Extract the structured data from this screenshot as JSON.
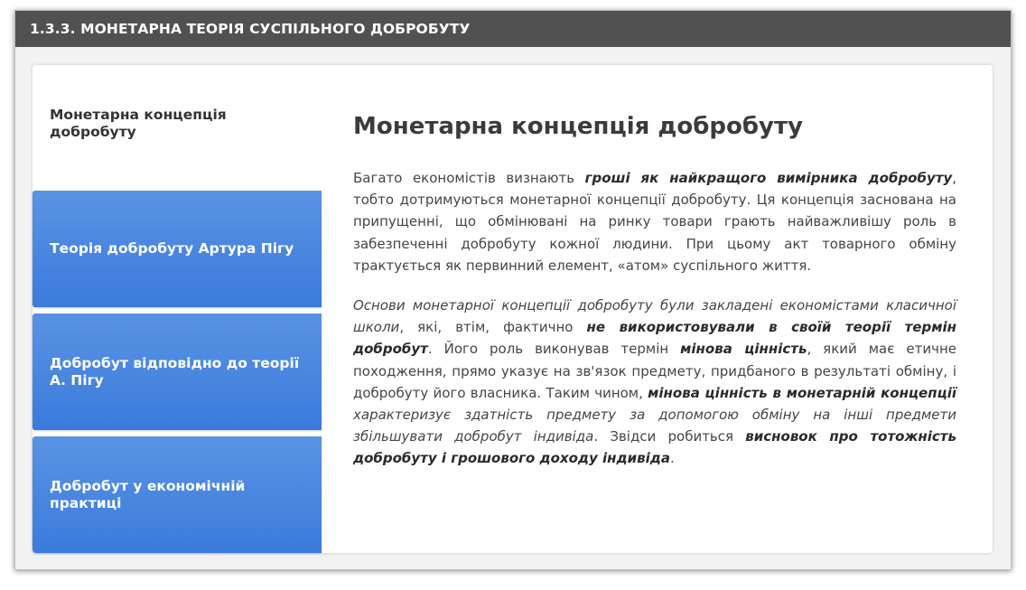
{
  "window": {
    "title": "1.3.3. МОНЕТАРНА ТЕОРІЯ СУСПІЛЬНОГО ДОБРОБУТУ"
  },
  "tabs": [
    {
      "label": "Монетарна концепція добробуту",
      "active": true
    },
    {
      "label": "Теорія добробуту Артура Пігу",
      "active": false
    },
    {
      "label": "Добробут відповідно до теорії А. Пігу",
      "active": false
    },
    {
      "label": "Добробут у економічній практиці",
      "active": false
    }
  ],
  "content": {
    "heading": "Монетарна концепція добробуту",
    "p1": {
      "t1": "Багато економістів визнають ",
      "b1": "гроші як найкращого вимірника добробуту",
      "t2": ", тобто дотримуються монетарної концепції добробуту. Ця концепція заснована на припущенні, що обмінювані на ринку товари грають найважливішу роль в забезпеченні добробуту кожної людини. При цьому акт товарного обміну трактується як первинний елемент, «атом» суспільного життя."
    },
    "p2": {
      "i1": "Основи монетарної концепції добробуту були закладені економістами класичної школи",
      "t1": ", які, втім, фактично ",
      "b1": "не використовували в своїй теорії термін добробут",
      "t2": ". Його роль виконував термін ",
      "b2": "мінова цінність",
      "t3": ", який має етичне походження, прямо указує на зв'язок предмету, придбаного в результаті обміну, і добробуту його власника. Таким чином, ",
      "b3": "мінова цінність в монетарній концепції",
      "i2": " характеризує здатність предмету за допомогою обміну на інші предмети збільшувати добробут індивіда",
      "t4": ". Звідси робиться ",
      "b4": "висновок про тотожність добробуту і грошового доходу індивіда",
      "t5": "."
    }
  },
  "colors": {
    "titlebar_bg": "#515151",
    "tab_inactive_top": "#5a93e2",
    "tab_inactive_bottom": "#3a7bdc",
    "text": "#454545"
  }
}
